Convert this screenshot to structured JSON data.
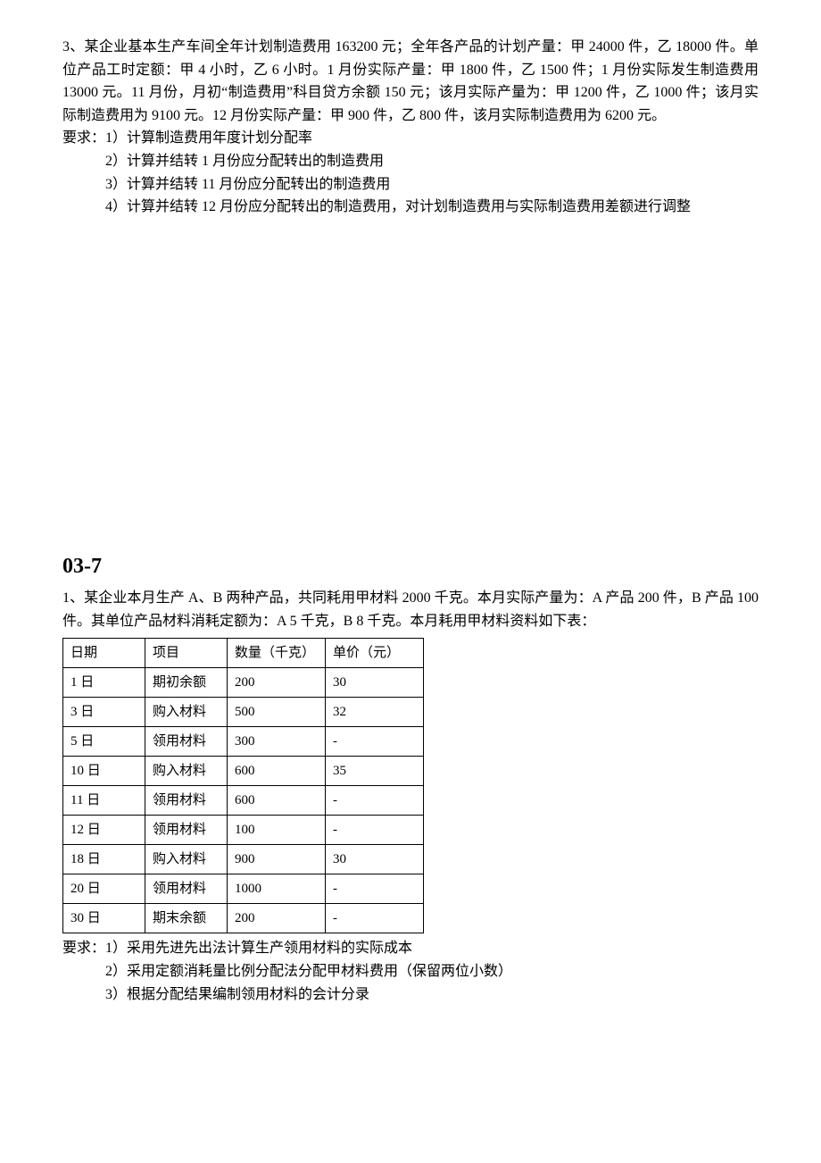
{
  "q3": {
    "text": "3、某企业基本生产车间全年计划制造费用 163200 元；全年各产品的计划产量：甲 24000 件，乙 18000 件。单位产品工时定额：甲 4 小时，乙 6 小时。1 月份实际产量：甲 1800 件，乙 1500 件；1 月份实际发生制造费用 13000 元。11 月份，月初“制造费用”科目贷方余额 150 元；该月实际产量为：甲 1200 件，乙 1000 件；该月实际制造费用为 9100 元。12 月份实际产量：甲 900 件，乙 800 件，该月实际制造费用为 6200 元。",
    "req_label": "要求：1）计算制造费用年度计划分配率",
    "reqs": [
      "2）计算并结转 1 月份应分配转出的制造费用",
      "3）计算并结转 11 月份应分配转出的制造费用",
      "4）计算并结转 12 月份应分配转出的制造费用，对计划制造费用与实际制造费用差额进行调整"
    ]
  },
  "section_heading": "03-7",
  "q1": {
    "text": "1、某企业本月生产 A、B 两种产品，共同耗用甲材料 2000 千克。本月实际产量为：A 产品 200 件，B 产品 100 件。其单位产品材料消耗定额为：A 5 千克，B 8 千克。本月耗用甲材料资料如下表：",
    "table": {
      "headers": [
        "日期",
        "项目",
        "数量（千克）",
        "单价（元）"
      ],
      "rows": [
        [
          "1 日",
          "期初余额",
          "200",
          "30"
        ],
        [
          "3 日",
          "购入材料",
          "500",
          "32"
        ],
        [
          "5 日",
          "领用材料",
          "300",
          "-"
        ],
        [
          "10 日",
          "购入材料",
          "600",
          "35"
        ],
        [
          "11 日",
          "领用材料",
          "600",
          "-"
        ],
        [
          "12 日",
          "领用材料",
          "100",
          "-"
        ],
        [
          "18 日",
          "购入材料",
          "900",
          "30"
        ],
        [
          "20 日",
          "领用材料",
          "1000",
          "-"
        ],
        [
          "30 日",
          "期末余额",
          "200",
          "-"
        ]
      ]
    },
    "req_label": "要求：1）采用先进先出法计算生产领用材料的实际成本",
    "reqs": [
      "2）采用定额消耗量比例分配法分配甲材料费用（保留两位小数）",
      "3）根据分配结果编制领用材料的会计分录"
    ]
  }
}
